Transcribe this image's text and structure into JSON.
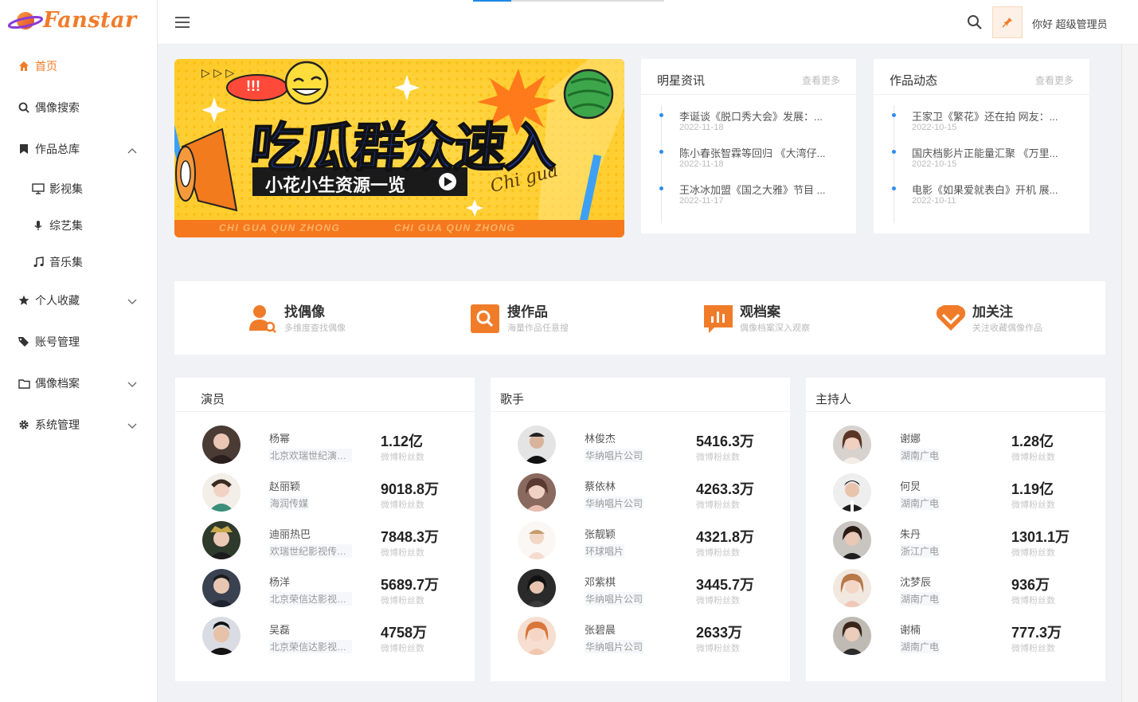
{
  "app": {
    "logo_text": "Fanstar",
    "greeting": "你好 超级管理员",
    "colors": {
      "brand": "#f07c2a",
      "accent_blue": "#2d8cf0"
    }
  },
  "sidebar": {
    "items": [
      {
        "label": "首页",
        "icon": "home-icon"
      },
      {
        "label": "偶像搜索",
        "icon": "search-icon"
      },
      {
        "label": "作品总库",
        "icon": "bookmark-icon"
      },
      {
        "label": "影视集",
        "icon": "monitor-icon"
      },
      {
        "label": "综艺集",
        "icon": "microphone-icon"
      },
      {
        "label": "音乐集",
        "icon": "music-icon"
      },
      {
        "label": "个人收藏",
        "icon": "star-icon"
      },
      {
        "label": "账号管理",
        "icon": "tags-icon"
      },
      {
        "label": "偶像档案",
        "icon": "folder-icon"
      },
      {
        "label": "系统管理",
        "icon": "gear-icon"
      }
    ]
  },
  "banner": {
    "headline": "吃瓜群众速入",
    "exclaim": "!!!",
    "subtitle": "小花小生资源一览",
    "script": "Chi gua",
    "footer_left": "CHI GUA QUN ZHONG",
    "footer_right": "CHI GUA QUN ZHONG"
  },
  "news": {
    "title": "明星资讯",
    "more": "查看更多",
    "items": [
      {
        "title": "李诞谈《脱口秀大会》发展：...",
        "date": "2022-11-18"
      },
      {
        "title": "陈小春张智霖等回归 《大湾仔...",
        "date": "2022-11-18"
      },
      {
        "title": "王冰冰加盟《国之大雅》节目 ...",
        "date": "2022-11-17"
      }
    ]
  },
  "works": {
    "title": "作品动态",
    "more": "查看更多",
    "items": [
      {
        "title": "王家卫《繁花》还在拍 网友：...",
        "date": "2022-10-15"
      },
      {
        "title": "国庆档影片正能量汇聚 《万里...",
        "date": "2022-10-15"
      },
      {
        "title": "电影《如果爱就表白》开机 展...",
        "date": "2022-10-11"
      }
    ]
  },
  "features": [
    {
      "title": "找偶像",
      "subtitle": "多维度查找偶像",
      "icon": "user-search-icon"
    },
    {
      "title": "搜作品",
      "subtitle": "海量作品任意搜",
      "icon": "magnifier-icon"
    },
    {
      "title": "观档案",
      "subtitle": "偶像档案深入观察",
      "icon": "chart-icon"
    },
    {
      "title": "加关注",
      "subtitle": "关注收藏偶像作品",
      "icon": "heart-icon"
    }
  ],
  "rankings": [
    {
      "title": "演员",
      "rows": [
        {
          "name": "杨幂",
          "company": "北京欢瑞世纪演艺...",
          "fans": "1.12亿",
          "label": "微博粉丝数"
        },
        {
          "name": "赵丽颖",
          "company": "海润传媒",
          "fans": "9018.8万",
          "label": "微博粉丝数"
        },
        {
          "name": "迪丽热巴",
          "company": "欢瑞世纪影视传媒...",
          "fans": "7848.3万",
          "label": "微博粉丝数"
        },
        {
          "name": "杨洋",
          "company": "北京荣信达影视艺...",
          "fans": "5689.7万",
          "label": "微博粉丝数"
        },
        {
          "name": "吴磊",
          "company": "北京荣信达影视艺...",
          "fans": "4758万",
          "label": "微博粉丝数"
        }
      ]
    },
    {
      "title": "歌手",
      "rows": [
        {
          "name": "林俊杰",
          "company": "华纳唱片公司",
          "fans": "5416.3万",
          "label": "微博粉丝数"
        },
        {
          "name": "蔡依林",
          "company": "华纳唱片公司",
          "fans": "4263.3万",
          "label": "微博粉丝数"
        },
        {
          "name": "张靓颖",
          "company": "环球唱片",
          "fans": "4321.8万",
          "label": "微博粉丝数"
        },
        {
          "name": "邓紫棋",
          "company": "华纳唱片公司",
          "fans": "3445.7万",
          "label": "微博粉丝数"
        },
        {
          "name": "张碧晨",
          "company": "华纳唱片公司",
          "fans": "2633万",
          "label": "微博粉丝数"
        }
      ]
    },
    {
      "title": "主持人",
      "rows": [
        {
          "name": "谢娜",
          "company": "湖南广电",
          "fans": "1.28亿",
          "label": "微博粉丝数"
        },
        {
          "name": "何炅",
          "company": "湖南广电",
          "fans": "1.19亿",
          "label": "微博粉丝数"
        },
        {
          "name": "朱丹",
          "company": "浙江广电",
          "fans": "1301.1万",
          "label": "微博粉丝数"
        },
        {
          "name": "沈梦辰",
          "company": "湖南广电",
          "fans": "936万",
          "label": "微博粉丝数"
        },
        {
          "name": "谢楠",
          "company": "湖南广电",
          "fans": "777.3万",
          "label": "微博粉丝数"
        }
      ]
    }
  ]
}
